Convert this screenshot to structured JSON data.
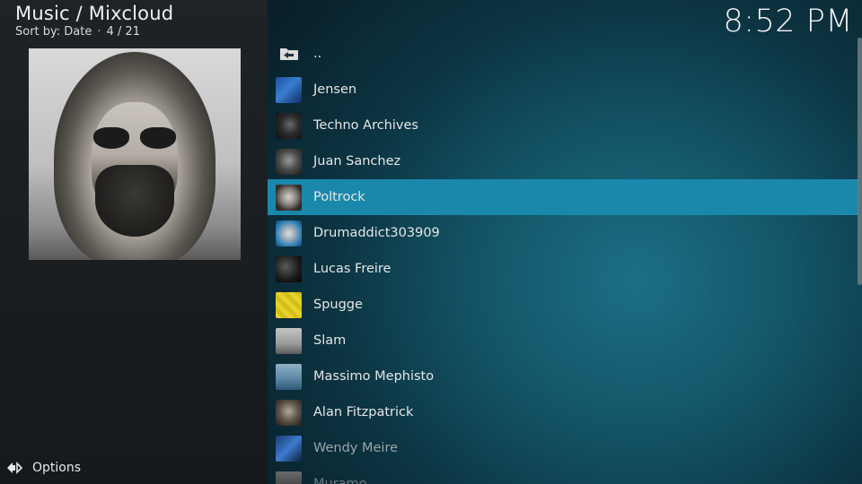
{
  "header": {
    "title": "Music / Mixcloud",
    "sort_label": "Sort by: Date",
    "separator": "·",
    "position": "4 / 21"
  },
  "clock": "8:52 PM",
  "footer": {
    "options_label": "Options"
  },
  "list": {
    "items": [
      {
        "label": "..",
        "icon": "folder-back-icon"
      },
      {
        "label": "Jensen",
        "icon": "jensen-thumbnail"
      },
      {
        "label": "Techno Archives",
        "icon": "techno-archives-thumbnail"
      },
      {
        "label": "Juan Sanchez",
        "icon": "juan-sanchez-thumbnail"
      },
      {
        "label": "Poltrock",
        "icon": "poltrock-thumbnail",
        "selected": true
      },
      {
        "label": "Drumaddict303909",
        "icon": "drumaddict-thumbnail"
      },
      {
        "label": "Lucas Freire",
        "icon": "lucas-freire-thumbnail"
      },
      {
        "label": "Spugge",
        "icon": "spugge-thumbnail"
      },
      {
        "label": "Slam",
        "icon": "slam-thumbnail"
      },
      {
        "label": "Massimo Mephisto",
        "icon": "massimo-mephisto-thumbnail"
      },
      {
        "label": "Alan Fitzpatrick",
        "icon": "alan-fitzpatrick-thumbnail"
      },
      {
        "label": "Wendy Meire",
        "icon": "wendy-meire-thumbnail"
      },
      {
        "label": "Muramo",
        "icon": "muramo-thumbnail"
      }
    ]
  },
  "colors": {
    "selected_row": "#1a88ab",
    "left_panel": "#1e2326",
    "right_panel_glow": "#1c6f86"
  }
}
